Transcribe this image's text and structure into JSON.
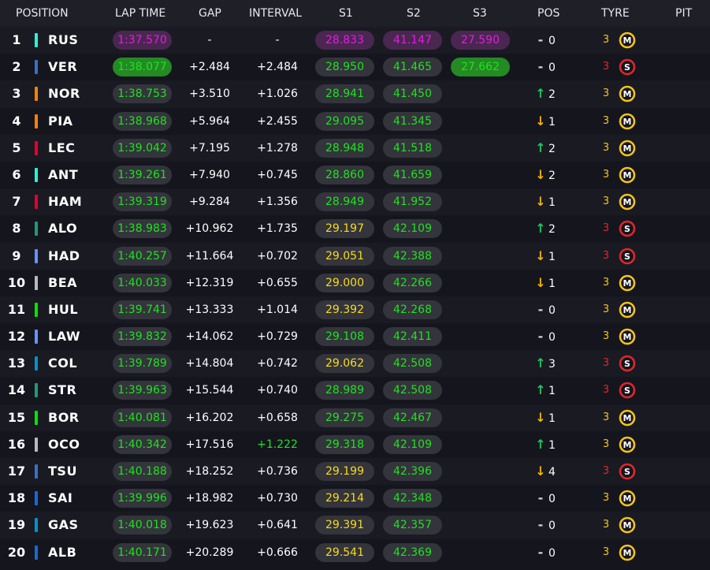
{
  "header": {
    "position": "POSITION",
    "lap_time": "LAP TIME",
    "gap": "GAP",
    "interval": "INTERVAL",
    "s1": "S1",
    "s2": "S2",
    "s3": "S3",
    "pos": "POS",
    "tyre": "TYRE",
    "pit": "PIT"
  },
  "colors": {
    "purple_text": "#e01ee0",
    "purple_bg": "#4a2750",
    "green_text": "#1ee31e",
    "green_bg": "#2f4a2f",
    "green_best_bg": "#248a24",
    "yellow_text": "#f5dc1e",
    "neutral_bg": "#34343c",
    "arrow_up": "#22c55e",
    "arrow_down": "#f0b400",
    "tyre_medium": "#f5c518",
    "tyre_soft": "#e0282a"
  },
  "rows": [
    {
      "pos": "1",
      "driver": "RUS",
      "team_color": "#27f4d2",
      "lap": "1:37.570",
      "lap_style": "purple",
      "gap": "-",
      "interval": "-",
      "interval_green": false,
      "s1": "28.833",
      "s1_style": "purple",
      "s2": "41.147",
      "s2_style": "purple",
      "s3": "27.590",
      "s3_style": "purple",
      "change_dir": "none",
      "change": "0",
      "tyre_age": "3",
      "tyre": "medium",
      "tyre_letter": "M"
    },
    {
      "pos": "2",
      "driver": "VER",
      "team_color": "#3671c6",
      "lap": "1:38.077",
      "lap_style": "green_best",
      "gap": "+2.484",
      "interval": "+2.484",
      "interval_green": false,
      "s1": "28.950",
      "s1_style": "green",
      "s2": "41.465",
      "s2_style": "green",
      "s3": "27.662",
      "s3_style": "green_best",
      "change_dir": "none",
      "change": "0",
      "tyre_age": "3",
      "tyre": "soft",
      "tyre_letter": "S"
    },
    {
      "pos": "3",
      "driver": "NOR",
      "team_color": "#ff8000",
      "lap": "1:38.753",
      "lap_style": "green",
      "gap": "+3.510",
      "interval": "+1.026",
      "interval_green": false,
      "s1": "28.941",
      "s1_style": "green",
      "s2": "41.450",
      "s2_style": "green",
      "s3": "",
      "s3_style": "none",
      "change_dir": "up",
      "change": "2",
      "tyre_age": "3",
      "tyre": "medium",
      "tyre_letter": "M"
    },
    {
      "pos": "4",
      "driver": "PIA",
      "team_color": "#ff8000",
      "lap": "1:38.968",
      "lap_style": "green",
      "gap": "+5.964",
      "interval": "+2.455",
      "interval_green": false,
      "s1": "29.095",
      "s1_style": "green",
      "s2": "41.345",
      "s2_style": "green",
      "s3": "",
      "s3_style": "none",
      "change_dir": "down",
      "change": "1",
      "tyre_age": "3",
      "tyre": "medium",
      "tyre_letter": "M"
    },
    {
      "pos": "5",
      "driver": "LEC",
      "team_color": "#e8002d",
      "lap": "1:39.042",
      "lap_style": "green",
      "gap": "+7.195",
      "interval": "+1.278",
      "interval_green": false,
      "s1": "28.948",
      "s1_style": "green",
      "s2": "41.518",
      "s2_style": "green",
      "s3": "",
      "s3_style": "none",
      "change_dir": "up",
      "change": "2",
      "tyre_age": "3",
      "tyre": "medium",
      "tyre_letter": "M"
    },
    {
      "pos": "6",
      "driver": "ANT",
      "team_color": "#27f4d2",
      "lap": "1:39.261",
      "lap_style": "green",
      "gap": "+7.940",
      "interval": "+0.745",
      "interval_green": false,
      "s1": "28.860",
      "s1_style": "green",
      "s2": "41.659",
      "s2_style": "green",
      "s3": "",
      "s3_style": "none",
      "change_dir": "down",
      "change": "2",
      "tyre_age": "3",
      "tyre": "medium",
      "tyre_letter": "M"
    },
    {
      "pos": "7",
      "driver": "HAM",
      "team_color": "#e8002d",
      "lap": "1:39.319",
      "lap_style": "green",
      "gap": "+9.284",
      "interval": "+1.356",
      "interval_green": false,
      "s1": "28.949",
      "s1_style": "green",
      "s2": "41.952",
      "s2_style": "green",
      "s3": "",
      "s3_style": "none",
      "change_dir": "down",
      "change": "1",
      "tyre_age": "3",
      "tyre": "medium",
      "tyre_letter": "M"
    },
    {
      "pos": "8",
      "driver": "ALO",
      "team_color": "#229971",
      "lap": "1:38.983",
      "lap_style": "green",
      "gap": "+10.962",
      "interval": "+1.735",
      "interval_green": false,
      "s1": "29.197",
      "s1_style": "yellow",
      "s2": "42.109",
      "s2_style": "green",
      "s3": "",
      "s3_style": "none",
      "change_dir": "up",
      "change": "2",
      "tyre_age": "3",
      "tyre": "soft",
      "tyre_letter": "S"
    },
    {
      "pos": "9",
      "driver": "HAD",
      "team_color": "#6692ff",
      "lap": "1:40.257",
      "lap_style": "green",
      "gap": "+11.664",
      "interval": "+0.702",
      "interval_green": false,
      "s1": "29.051",
      "s1_style": "yellow",
      "s2": "42.388",
      "s2_style": "green",
      "s3": "",
      "s3_style": "none",
      "change_dir": "down",
      "change": "1",
      "tyre_age": "3",
      "tyre": "soft",
      "tyre_letter": "S"
    },
    {
      "pos": "10",
      "driver": "BEA",
      "team_color": "#b6babd",
      "lap": "1:40.033",
      "lap_style": "green",
      "gap": "+12.319",
      "interval": "+0.655",
      "interval_green": false,
      "s1": "29.000",
      "s1_style": "yellow",
      "s2": "42.266",
      "s2_style": "green",
      "s3": "",
      "s3_style": "none",
      "change_dir": "down",
      "change": "1",
      "tyre_age": "3",
      "tyre": "medium",
      "tyre_letter": "M"
    },
    {
      "pos": "11",
      "driver": "HUL",
      "team_color": "#00e701",
      "lap": "1:39.741",
      "lap_style": "green",
      "gap": "+13.333",
      "interval": "+1.014",
      "interval_green": false,
      "s1": "29.392",
      "s1_style": "yellow",
      "s2": "42.268",
      "s2_style": "green",
      "s3": "",
      "s3_style": "none",
      "change_dir": "none",
      "change": "0",
      "tyre_age": "3",
      "tyre": "medium",
      "tyre_letter": "M"
    },
    {
      "pos": "12",
      "driver": "LAW",
      "team_color": "#6692ff",
      "lap": "1:39.832",
      "lap_style": "green",
      "gap": "+14.062",
      "interval": "+0.729",
      "interval_green": false,
      "s1": "29.108",
      "s1_style": "green",
      "s2": "42.411",
      "s2_style": "green",
      "s3": "",
      "s3_style": "none",
      "change_dir": "none",
      "change": "0",
      "tyre_age": "3",
      "tyre": "medium",
      "tyre_letter": "M"
    },
    {
      "pos": "13",
      "driver": "COL",
      "team_color": "#0093cc",
      "lap": "1:39.789",
      "lap_style": "green",
      "gap": "+14.804",
      "interval": "+0.742",
      "interval_green": false,
      "s1": "29.062",
      "s1_style": "yellow",
      "s2": "42.508",
      "s2_style": "green",
      "s3": "",
      "s3_style": "none",
      "change_dir": "up",
      "change": "3",
      "tyre_age": "3",
      "tyre": "soft",
      "tyre_letter": "S"
    },
    {
      "pos": "14",
      "driver": "STR",
      "team_color": "#229971",
      "lap": "1:39.963",
      "lap_style": "green",
      "gap": "+15.544",
      "interval": "+0.740",
      "interval_green": false,
      "s1": "28.989",
      "s1_style": "green",
      "s2": "42.508",
      "s2_style": "green",
      "s3": "",
      "s3_style": "none",
      "change_dir": "up",
      "change": "1",
      "tyre_age": "3",
      "tyre": "soft",
      "tyre_letter": "S"
    },
    {
      "pos": "15",
      "driver": "BOR",
      "team_color": "#00e701",
      "lap": "1:40.081",
      "lap_style": "green",
      "gap": "+16.202",
      "interval": "+0.658",
      "interval_green": false,
      "s1": "29.275",
      "s1_style": "green",
      "s2": "42.467",
      "s2_style": "green",
      "s3": "",
      "s3_style": "none",
      "change_dir": "down",
      "change": "1",
      "tyre_age": "3",
      "tyre": "medium",
      "tyre_letter": "M"
    },
    {
      "pos": "16",
      "driver": "OCO",
      "team_color": "#b6babd",
      "lap": "1:40.342",
      "lap_style": "green",
      "gap": "+17.516",
      "interval": "+1.222",
      "interval_green": true,
      "s1": "29.318",
      "s1_style": "green",
      "s2": "42.109",
      "s2_style": "green",
      "s3": "",
      "s3_style": "none",
      "change_dir": "up",
      "change": "1",
      "tyre_age": "3",
      "tyre": "medium",
      "tyre_letter": "M"
    },
    {
      "pos": "17",
      "driver": "TSU",
      "team_color": "#3671c6",
      "lap": "1:40.188",
      "lap_style": "green",
      "gap": "+18.252",
      "interval": "+0.736",
      "interval_green": false,
      "s1": "29.199",
      "s1_style": "yellow",
      "s2": "42.396",
      "s2_style": "green",
      "s3": "",
      "s3_style": "none",
      "change_dir": "down",
      "change": "4",
      "tyre_age": "3",
      "tyre": "soft",
      "tyre_letter": "S"
    },
    {
      "pos": "18",
      "driver": "SAI",
      "team_color": "#1868db",
      "lap": "1:39.996",
      "lap_style": "green",
      "gap": "+18.982",
      "interval": "+0.730",
      "interval_green": false,
      "s1": "29.214",
      "s1_style": "yellow",
      "s2": "42.348",
      "s2_style": "green",
      "s3": "",
      "s3_style": "none",
      "change_dir": "none",
      "change": "0",
      "tyre_age": "3",
      "tyre": "medium",
      "tyre_letter": "M"
    },
    {
      "pos": "19",
      "driver": "GAS",
      "team_color": "#0093cc",
      "lap": "1:40.018",
      "lap_style": "green",
      "gap": "+19.623",
      "interval": "+0.641",
      "interval_green": false,
      "s1": "29.391",
      "s1_style": "yellow",
      "s2": "42.357",
      "s2_style": "green",
      "s3": "",
      "s3_style": "none",
      "change_dir": "none",
      "change": "0",
      "tyre_age": "3",
      "tyre": "medium",
      "tyre_letter": "M"
    },
    {
      "pos": "20",
      "driver": "ALB",
      "team_color": "#1868db",
      "lap": "1:40.171",
      "lap_style": "green",
      "gap": "+20.289",
      "interval": "+0.666",
      "interval_green": false,
      "s1": "29.541",
      "s1_style": "yellow",
      "s2": "42.369",
      "s2_style": "green",
      "s3": "",
      "s3_style": "none",
      "change_dir": "none",
      "change": "0",
      "tyre_age": "3",
      "tyre": "medium",
      "tyre_letter": "M"
    }
  ]
}
